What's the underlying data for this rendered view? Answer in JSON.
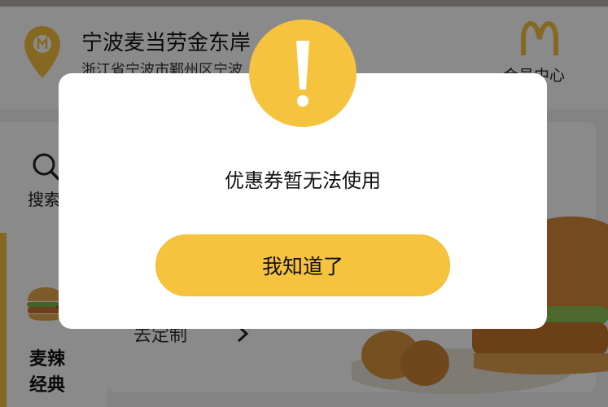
{
  "store": {
    "name": "宁波麦当劳金东岸",
    "address": "浙江省宁波市鄞州区宁波",
    "member_label": "会员中心"
  },
  "sidebar": {
    "search_label": "搜索",
    "category_label": "麦辣经典"
  },
  "content": {
    "customize_label": "去定制"
  },
  "dialog": {
    "message": "优惠券暂无法使用",
    "confirm_label": "我知道了"
  },
  "colors": {
    "accent": "#f6c33f",
    "overlay": "rgba(0,0,0,0.46)",
    "dialog_bg": "#ffffff"
  },
  "icons": {
    "alert": "exclamation-icon",
    "location": "location-pin-icon",
    "logo": "golden-arches-logo",
    "search": "search-icon",
    "category": "burger-icon",
    "arrow": "chevron-right-icon"
  }
}
